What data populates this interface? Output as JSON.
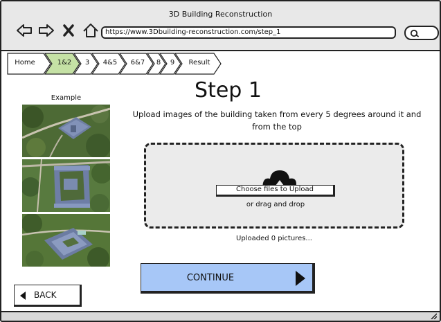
{
  "window": {
    "title": "3D Building Reconstruction"
  },
  "browser": {
    "url": "https://www.3Dbuilding-reconstruction.com/step_1",
    "nav_icons": [
      "back-arrow-icon",
      "forward-arrow-icon",
      "close-x-icon",
      "home-icon"
    ],
    "search_icon": "search-icon"
  },
  "tabs": {
    "items": [
      {
        "label": "Home",
        "active": false
      },
      {
        "label": "1&2",
        "active": true
      },
      {
        "label": "3",
        "active": false
      },
      {
        "label": "4&5",
        "active": false
      },
      {
        "label": "6&7",
        "active": false
      },
      {
        "label": "8",
        "active": false
      },
      {
        "label": "9",
        "active": false
      },
      {
        "label": "Result",
        "active": false
      }
    ],
    "active_color": "#c5e1a5"
  },
  "example": {
    "title": "Example"
  },
  "main": {
    "step_title": "Step 1",
    "instruction": "Upload images of the building taken from every 5 degrees around it and from the top",
    "upload": {
      "icon": "cloud-upload-icon",
      "choose_label": "Choose files to Upload",
      "drag_text": "or drag and drop"
    },
    "uploaded_text": "Uploaded 0 pictures...",
    "continue_label": "CONTINUE",
    "back_label": "BACK"
  },
  "colors": {
    "continue_bg": "#a7c7f7",
    "chrome_bg": "#e8e8e8",
    "dropzone_bg": "#ebebeb"
  }
}
